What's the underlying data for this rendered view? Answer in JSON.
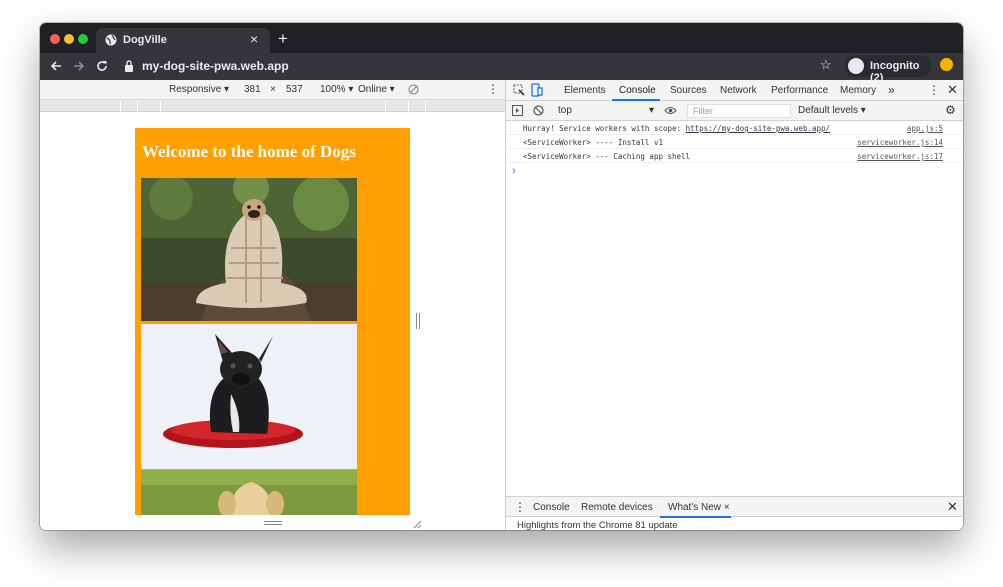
{
  "browser": {
    "tab_title": "DogVille",
    "tab_close": "×",
    "new_tab": "+",
    "url": "my-dog-site-pwa.web.app",
    "incognito_label": "Incognito (2)",
    "colors": {
      "frame": "#202124",
      "toolbar": "#35363a",
      "close": "#ff5f57",
      "minimize": "#febc2e",
      "maximize": "#28c840"
    }
  },
  "device_toolbar": {
    "device": "Responsive",
    "width": "381",
    "times": "×",
    "height": "537",
    "zoom": "100%",
    "throttle": "Online"
  },
  "page": {
    "heading": "Welcome to the home of Dogs",
    "background": "#ff9f00"
  },
  "devtools": {
    "tabs": [
      "Elements",
      "Console",
      "Sources",
      "Network",
      "Performance",
      "Memory"
    ],
    "active_tab": "Console",
    "more": "»",
    "context": "top",
    "filter_placeholder": "Filter",
    "levels": "Default levels ▾",
    "logs": [
      {
        "text": "Hurray! Service workers with scope: ",
        "link": "https://my-dog-site-pwa.web.app/",
        "source": "app.js:5"
      },
      {
        "text": "<ServiceWorker> ---- Install v1",
        "link": "",
        "source": "serviceworker.js:14"
      },
      {
        "text": "<ServiceWorker> --- Caching app shell",
        "link": "",
        "source": "serviceworker.js:17"
      }
    ],
    "prompt": "›",
    "drawer_tabs": [
      "Console",
      "Remote devices",
      "What's New"
    ],
    "drawer_close": "×",
    "drawer_text": "Highlights from the Chrome 81 update"
  }
}
